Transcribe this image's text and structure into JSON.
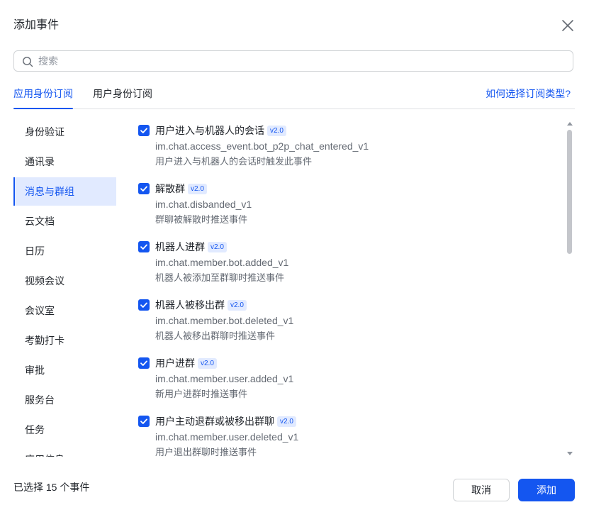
{
  "dialog": {
    "title": "添加事件",
    "search_placeholder": "搜索"
  },
  "tabs": [
    {
      "label": "应用身份订阅",
      "active": true
    },
    {
      "label": "用户身份订阅",
      "active": false
    }
  ],
  "help_link": "如何选择订阅类型?",
  "sidebar": {
    "items": [
      {
        "label": "身份验证"
      },
      {
        "label": "通讯录"
      },
      {
        "label": "消息与群组",
        "active": true
      },
      {
        "label": "云文档"
      },
      {
        "label": "日历"
      },
      {
        "label": "视频会议"
      },
      {
        "label": "会议室"
      },
      {
        "label": "考勤打卡"
      },
      {
        "label": "审批"
      },
      {
        "label": "服务台"
      },
      {
        "label": "任务"
      },
      {
        "label": "应用信息"
      }
    ]
  },
  "events": [
    {
      "name": "用户进入与机器人的会话",
      "version": "v2.0",
      "code": "im.chat.access_event.bot_p2p_chat_entered_v1",
      "desc": "用户进入与机器人的会话时触发此事件",
      "checked": true
    },
    {
      "name": "解散群",
      "version": "v2.0",
      "code": "im.chat.disbanded_v1",
      "desc": "群聊被解散时推送事件",
      "checked": true
    },
    {
      "name": "机器人进群",
      "version": "v2.0",
      "code": "im.chat.member.bot.added_v1",
      "desc": "机器人被添加至群聊时推送事件",
      "checked": true
    },
    {
      "name": "机器人被移出群",
      "version": "v2.0",
      "code": "im.chat.member.bot.deleted_v1",
      "desc": "机器人被移出群聊时推送事件",
      "checked": true
    },
    {
      "name": "用户进群",
      "version": "v2.0",
      "code": "im.chat.member.user.added_v1",
      "desc": "新用户进群时推送事件",
      "checked": true
    },
    {
      "name": "用户主动退群或被移出群聊",
      "version": "v2.0",
      "code": "im.chat.member.user.deleted_v1",
      "desc": "用户退出群聊时推送事件",
      "checked": true
    }
  ],
  "footer": {
    "selected_count": "已选择 15 个事件",
    "cancel_label": "取消",
    "add_label": "添加"
  },
  "colors": {
    "accent": "#1456f0",
    "accent_bg": "#e1eaff",
    "text": "#1f2329",
    "text_secondary": "#646a73",
    "border": "#d0d3d6"
  }
}
